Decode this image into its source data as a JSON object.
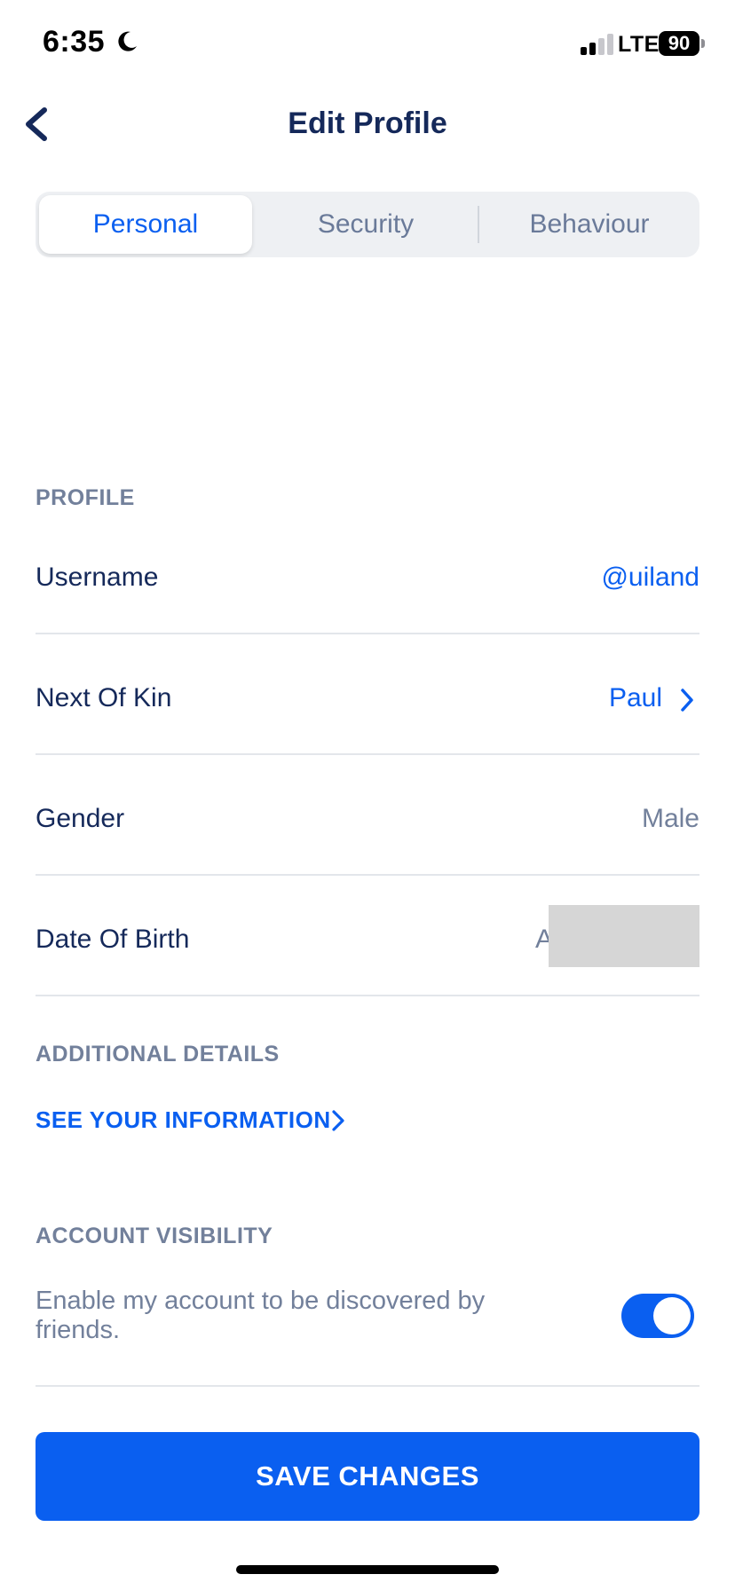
{
  "status_bar": {
    "time": "6:35",
    "network": "LTE",
    "battery": "90"
  },
  "header": {
    "title": "Edit Profile",
    "back_icon": "chevron-left-icon"
  },
  "tabs": [
    {
      "label": "Personal",
      "active": true
    },
    {
      "label": "Security",
      "active": false
    },
    {
      "label": "Behaviour",
      "active": false
    }
  ],
  "profile": {
    "section_title": "PROFILE",
    "rows": [
      {
        "label": "Username",
        "value": "@uiland"
      },
      {
        "label": "Next Of Kin",
        "value": "Paul"
      },
      {
        "label": "Gender",
        "value": "Male"
      },
      {
        "label": "Date Of Birth",
        "value": "A"
      }
    ]
  },
  "additional": {
    "section_title": "ADDITIONAL DETAILS",
    "link_label": "SEE YOUR INFORMATION"
  },
  "visibility": {
    "section_title": "ACCOUNT VISIBILITY",
    "description": "Enable my account to be discovered by friends.",
    "enabled": true
  },
  "save_button": "SAVE CHANGES",
  "colors": {
    "accent": "#0a5ff0",
    "title": "#15295a",
    "muted": "#72809b"
  }
}
